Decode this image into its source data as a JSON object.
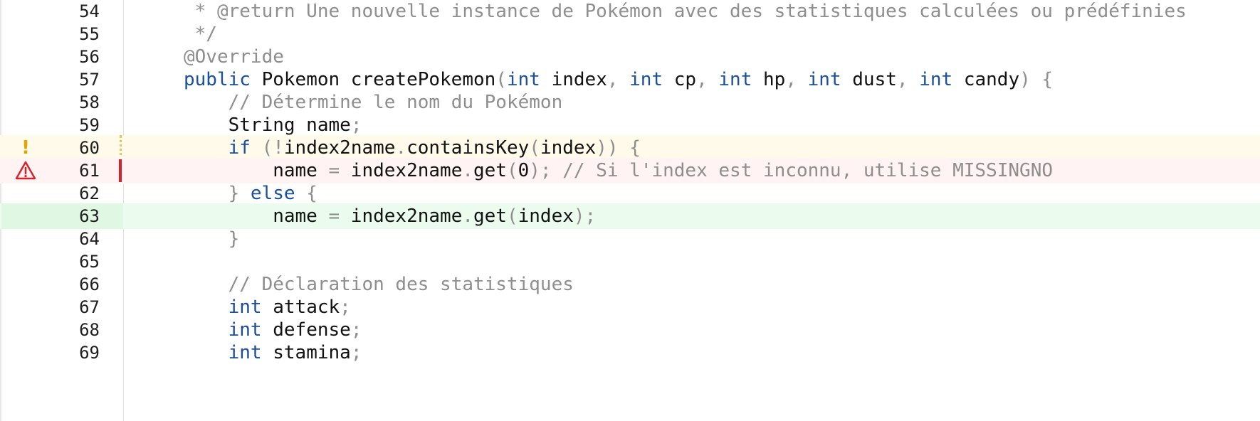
{
  "editor": {
    "lines": [
      {
        "number": "54",
        "text": " * @return Une nouvelle instance de Pokémon avec des statistiques calculées ou prédéfinies",
        "tokens": [
          {
            "t": " * @return Une nouvelle instance de Pokémon avec des statistiques calculées ou prédéfinies",
            "c": "cm"
          }
        ]
      },
      {
        "number": "55",
        "text": " */",
        "tokens": [
          {
            "t": " */",
            "c": "cm"
          }
        ]
      },
      {
        "number": "56",
        "text": "@Override",
        "tokens": [
          {
            "t": "@Override",
            "c": "an"
          }
        ]
      },
      {
        "number": "57",
        "text": "public Pokemon createPokemon(int index, int cp, int hp, int dust, int candy) {",
        "tokens": [
          {
            "t": "public",
            "c": "kw"
          },
          {
            "t": " Pokemon createPokemon",
            "c": ""
          },
          {
            "t": "(",
            "c": "pn"
          },
          {
            "t": "int",
            "c": "kw"
          },
          {
            "t": " index",
            "c": ""
          },
          {
            "t": ", ",
            "c": "pn"
          },
          {
            "t": "int",
            "c": "kw"
          },
          {
            "t": " cp",
            "c": ""
          },
          {
            "t": ", ",
            "c": "pn"
          },
          {
            "t": "int",
            "c": "kw"
          },
          {
            "t": " hp",
            "c": ""
          },
          {
            "t": ", ",
            "c": "pn"
          },
          {
            "t": "int",
            "c": "kw"
          },
          {
            "t": " dust",
            "c": ""
          },
          {
            "t": ", ",
            "c": "pn"
          },
          {
            "t": "int",
            "c": "kw"
          },
          {
            "t": " candy",
            "c": ""
          },
          {
            "t": ") {",
            "c": "pn"
          }
        ]
      },
      {
        "number": "58",
        "text": "    // Détermine le nom du Pokémon",
        "tokens": [
          {
            "t": "    ",
            "c": ""
          },
          {
            "t": "// Détermine le nom du Pokémon",
            "c": "cm"
          }
        ]
      },
      {
        "number": "59",
        "text": "    String name;",
        "tokens": [
          {
            "t": "    String name",
            "c": ""
          },
          {
            "t": ";",
            "c": "pn"
          }
        ]
      },
      {
        "number": "60",
        "state": "warning",
        "marker": "!",
        "text": "    if (!index2name.containsKey(index)) {",
        "tokens": [
          {
            "t": "    ",
            "c": ""
          },
          {
            "t": "if",
            "c": "kw"
          },
          {
            "t": " (!",
            "c": "pn"
          },
          {
            "t": "index2name",
            "c": ""
          },
          {
            "t": ".",
            "c": "pn"
          },
          {
            "t": "containsKey",
            "c": ""
          },
          {
            "t": "(",
            "c": "pn"
          },
          {
            "t": "index",
            "c": ""
          },
          {
            "t": ")) {",
            "c": "pn"
          }
        ]
      },
      {
        "number": "61",
        "state": "error",
        "marker": "triangle-warning",
        "text": "        name = index2name.get(0); // Si l'index est inconnu, utilise MISSINGNO",
        "tokens": [
          {
            "t": "        name ",
            "c": ""
          },
          {
            "t": "=",
            "c": "pn"
          },
          {
            "t": " index2name",
            "c": ""
          },
          {
            "t": ".",
            "c": "pn"
          },
          {
            "t": "get",
            "c": ""
          },
          {
            "t": "(",
            "c": "pn"
          },
          {
            "t": "0",
            "c": ""
          },
          {
            "t": "); ",
            "c": "pn"
          },
          {
            "t": "// Si l'index est inconnu, utilise MISSINGNO",
            "c": "cm"
          }
        ]
      },
      {
        "number": "62",
        "text": "    } else {",
        "tokens": [
          {
            "t": "    } ",
            "c": "pn"
          },
          {
            "t": "else",
            "c": "kw"
          },
          {
            "t": " {",
            "c": "pn"
          }
        ]
      },
      {
        "number": "63",
        "state": "added",
        "text": "        name = index2name.get(index);",
        "tokens": [
          {
            "t": "        name ",
            "c": ""
          },
          {
            "t": "=",
            "c": "pn"
          },
          {
            "t": " index2name",
            "c": ""
          },
          {
            "t": ".",
            "c": "pn"
          },
          {
            "t": "get",
            "c": ""
          },
          {
            "t": "(",
            "c": "pn"
          },
          {
            "t": "index",
            "c": ""
          },
          {
            "t": ");",
            "c": "pn"
          }
        ]
      },
      {
        "number": "64",
        "text": "    }",
        "tokens": [
          {
            "t": "    }",
            "c": "pn"
          }
        ]
      },
      {
        "number": "65",
        "text": "",
        "tokens": []
      },
      {
        "number": "66",
        "text": "    // Déclaration des statistiques",
        "tokens": [
          {
            "t": "    ",
            "c": ""
          },
          {
            "t": "// Déclaration des statistiques",
            "c": "cm"
          }
        ]
      },
      {
        "number": "67",
        "text": "    int attack;",
        "tokens": [
          {
            "t": "    ",
            "c": ""
          },
          {
            "t": "int",
            "c": "kw"
          },
          {
            "t": " attack",
            "c": ""
          },
          {
            "t": ";",
            "c": "pn"
          }
        ]
      },
      {
        "number": "68",
        "text": "    int defense;",
        "tokens": [
          {
            "t": "    ",
            "c": ""
          },
          {
            "t": "int",
            "c": "kw"
          },
          {
            "t": " defense",
            "c": ""
          },
          {
            "t": ";",
            "c": "pn"
          }
        ]
      },
      {
        "number": "69",
        "text": "    int stamina;",
        "tokens": [
          {
            "t": "    ",
            "c": ""
          },
          {
            "t": "int",
            "c": "kw"
          },
          {
            "t": " stamina",
            "c": ""
          },
          {
            "t": ";",
            "c": "pn"
          }
        ]
      }
    ]
  },
  "colors": {
    "keyword": "#1a4f9c",
    "comment": "#8e8e8e",
    "warning_line": "#fffaea",
    "error_line": "#fff3f3",
    "added_line": "#ebfcef",
    "error_marker": "#d8202a",
    "warning_marker": "#e0a800"
  }
}
